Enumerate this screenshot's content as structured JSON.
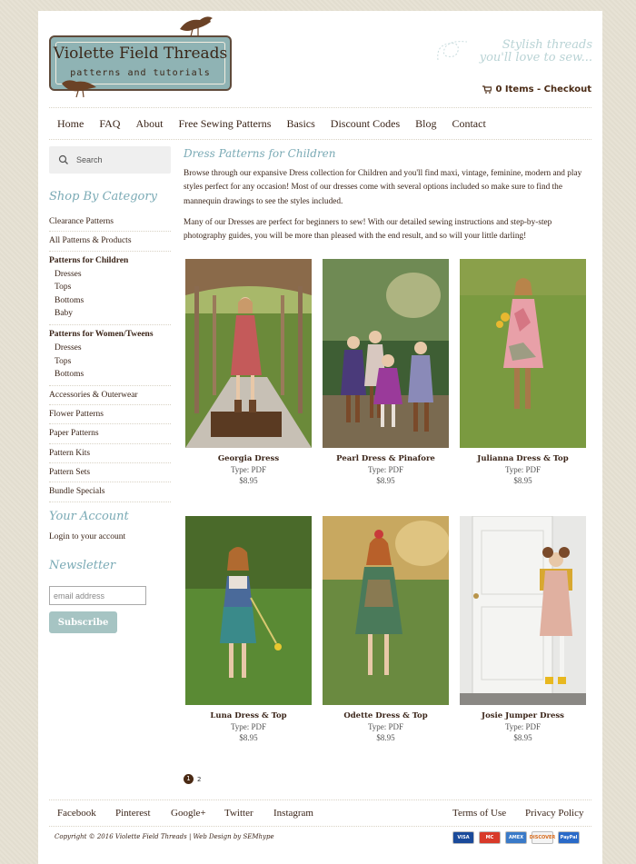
{
  "site": {
    "logo_title": "Violette Field Threads",
    "logo_subtitle": "patterns and tutorials",
    "tagline_line1": "Stylish threads",
    "tagline_line2": "you'll love to sew...",
    "cart_label": "0 Items - Checkout"
  },
  "nav": [
    "Home",
    "FAQ",
    "About",
    "Free Sewing Patterns",
    "Basics",
    "Discount Codes",
    "Blog",
    "Contact"
  ],
  "search": {
    "placeholder": "Search"
  },
  "sidebar": {
    "shop_heading": "Shop By Category",
    "categories": {
      "clearance": "Clearance Patterns",
      "all": "All Patterns & Products",
      "children_title": "Patterns for Children",
      "children_items": [
        "Dresses",
        "Tops",
        "Bottoms",
        "Baby"
      ],
      "women_title": "Patterns for Women/Tweens",
      "women_items": [
        "Dresses",
        "Tops",
        "Bottoms"
      ],
      "accessories": "Accessories & Outerwear",
      "flower": "Flower Patterns",
      "paper": "Paper Patterns",
      "kits": "Pattern Kits",
      "sets": "Pattern Sets",
      "bundle": "Bundle Specials"
    },
    "account_heading": "Your Account",
    "account_link": "Login to your account",
    "newsletter_heading": "Newsletter",
    "email_placeholder": "email address",
    "subscribe_label": "Subscribe"
  },
  "main": {
    "title": "Dress Patterns for Children",
    "paragraph1": "Browse through our expansive Dress collection for Children and you'll find maxi, vintage, feminine, modern and play styles perfect for any occasion! Most of our dresses come with several options included so make sure to find the mannequin drawings to see the styles included.",
    "paragraph2": "Many of our Dresses are perfect for beginners to sew! With our detailed sewing instructions and step-by-step photography guides, you will be more than pleased with the end result, and so will your little darling!",
    "products": [
      {
        "name": "Georgia Dress",
        "type": "Type: PDF",
        "price": "$8.95"
      },
      {
        "name": "Pearl Dress & Pinafore",
        "type": "Type: PDF",
        "price": "$8.95"
      },
      {
        "name": "Julianna Dress & Top",
        "type": "Type: PDF",
        "price": "$8.95"
      },
      {
        "name": "Luna Dress & Top",
        "type": "Type: PDF",
        "price": "$8.95"
      },
      {
        "name": "Odette Dress & Top",
        "type": "Type: PDF",
        "price": "$8.95"
      },
      {
        "name": "Josie Jumper Dress",
        "type": "Type: PDF",
        "price": "$8.95"
      }
    ],
    "pages": [
      "1",
      "2"
    ]
  },
  "footer": {
    "social": [
      "Facebook",
      "Pinterest",
      "Google+",
      "Twitter",
      "Instagram"
    ],
    "terms": "Terms of Use",
    "privacy": "Privacy Policy",
    "copyright": "Copyright © 2016 Violette Field Threads | Web Design by SEMhype",
    "cards": [
      "VISA",
      "MC",
      "AMEX",
      "DISCOVER",
      "PayPal"
    ]
  },
  "colors": {
    "accent": "#7aaab5",
    "brown": "#4a2a14",
    "button": "#a6c4c3"
  }
}
